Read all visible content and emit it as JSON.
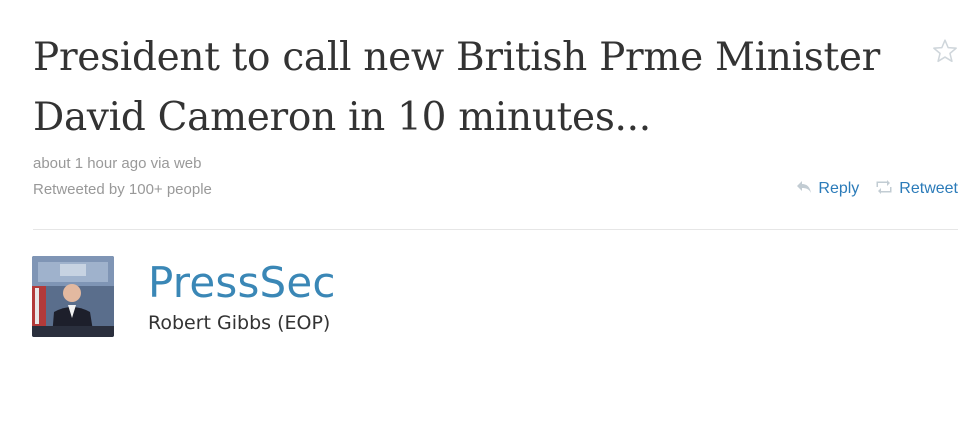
{
  "tweet": {
    "text": "President to call new British Prme Minister David Cameron in 10 minutes...",
    "timestamp": "about 1 hour ago via web",
    "retweet_info": "Retweeted by 100+ people"
  },
  "actions": {
    "reply_label": "Reply",
    "retweet_label": "Retweet"
  },
  "author": {
    "screen_name": "PressSec",
    "full_name": "Robert Gibbs (EOP)"
  },
  "icons": {
    "favorite": "star-icon",
    "reply": "reply-arrow-icon",
    "retweet": "retweet-icon"
  },
  "colors": {
    "link": "#2b7bb9",
    "screen_name": "#3a87b6",
    "text": "#333333",
    "meta": "#999999"
  }
}
